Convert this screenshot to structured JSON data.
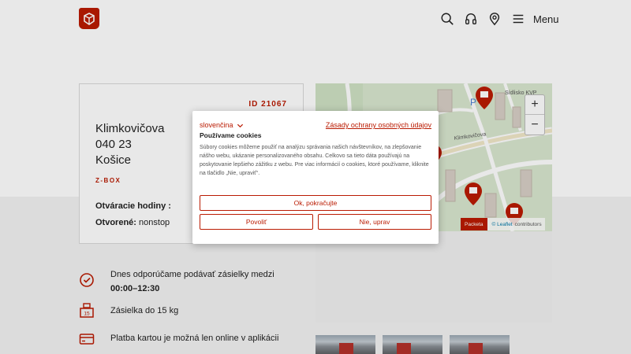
{
  "header": {
    "menu_label": "Menu"
  },
  "pickup_point": {
    "id_label": "ID 21067",
    "street": "Klimkovičova",
    "postal_code": "040 23",
    "city": "Košice",
    "type": "Z-BOX",
    "opening_hours_title": "Otváracie hodiny :",
    "opened_label": "Otvorené:",
    "opened_value": "nonstop"
  },
  "map": {
    "zoom_in": "+",
    "zoom_out": "−",
    "street_label": "Klimkovičova",
    "district_label": "Sídlisko KVP",
    "attribution_brand": "Packeta",
    "attribution_leaflet": "© Leaflet",
    "attribution_contributors": "contributors"
  },
  "features": [
    {
      "text_prefix": "Dnes odporúčame podávať zásielky medzi ",
      "text_bold": "00:00–12:30"
    },
    {
      "text": "Zásielka do 15 kg",
      "badge": "15"
    },
    {
      "text": "Platba kartou je možná len online v aplikácii"
    }
  ],
  "cookie_modal": {
    "language": "slovenčina",
    "policy_link": "Zásady ochrany osobných údajov",
    "title": "Používame cookies",
    "body": "Súbory cookies môžeme použiť na analýzu správania našich návštevníkov, na zlepšovanie nášho webu, ukázanie personalizovaného obsahu. Celkovo sa tieto dáta používajú na poskytovanie lepšieho zážitku z webu. Pre viac informácií o cookies, ktoré používame, kliknite na tlačidlo „Nie, upraviť“.",
    "ok_button": "Ok, pokračujte",
    "allow_button": "Povoliť",
    "adjust_button": "Nie, uprav"
  },
  "colors": {
    "brand": "#ba1b02",
    "overlay": "rgba(0,0,0,0.09)"
  }
}
